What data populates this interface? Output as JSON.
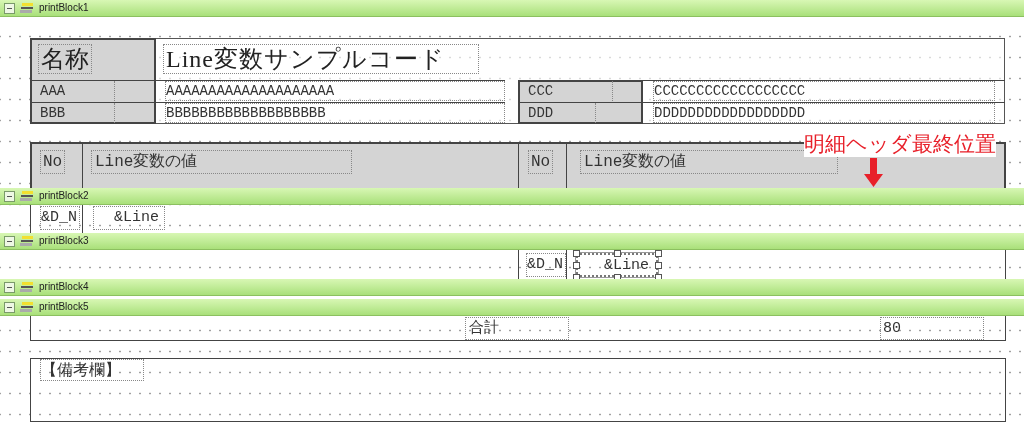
{
  "bands": [
    {
      "label": "printBlock1",
      "expanded": true
    },
    {
      "label": "printBlock2",
      "expanded": true
    },
    {
      "label": "printBlock3",
      "expanded": true
    },
    {
      "label": "printBlock4",
      "expanded": true
    },
    {
      "label": "printBlock5",
      "expanded": true
    }
  ],
  "header": {
    "title_label": "名称",
    "title": "Line変数サンプルコード",
    "fields": [
      {
        "label": "AAA",
        "value": "AAAAAAAAAAAAAAAAAAAA"
      },
      {
        "label": "BBB",
        "value": "BBBBBBBBBBBBBBBBBBB"
      },
      {
        "label": "CCC",
        "value": "CCCCCCCCCCCCCCCCCC"
      },
      {
        "label": "DDD",
        "value": "DDDDDDDDDDDDDDDDDD"
      }
    ]
  },
  "detail_header": {
    "columns": [
      "No",
      "Line変数の値",
      "No",
      "Line変数の値"
    ]
  },
  "annotation": "明細ヘッダ最終位置",
  "detail_rows": [
    {
      "no": "&D_N",
      "line": "&Line",
      "selected": false
    },
    {
      "no": "&D_N",
      "line": "&Line",
      "selected": true
    }
  ],
  "total": {
    "label": "合計",
    "value": "80"
  },
  "remarks": {
    "label": "【備考欄】"
  }
}
